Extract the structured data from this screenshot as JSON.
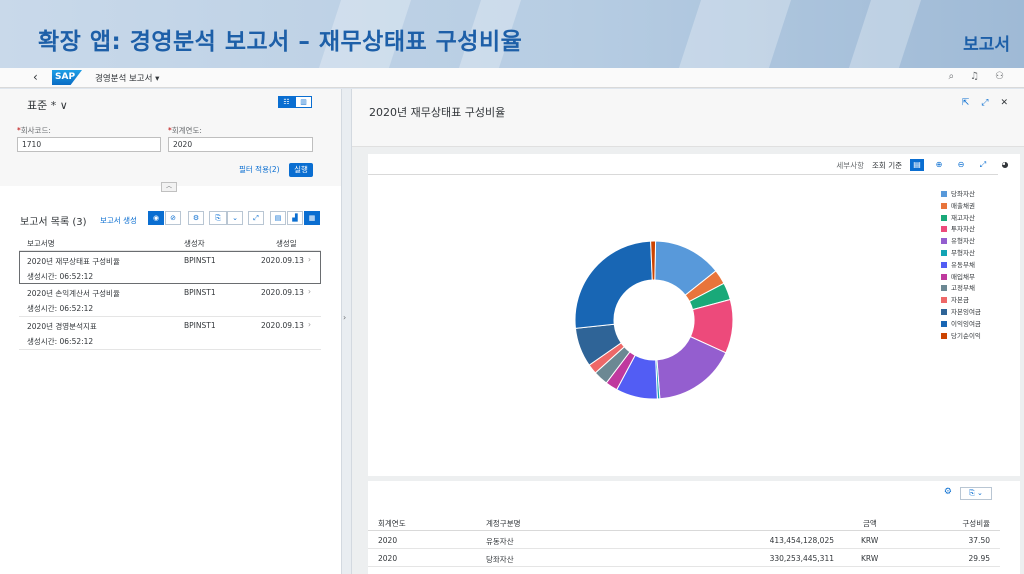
{
  "banner": {
    "title": "확장 앱: 경영분석 보고서 – 재무상태표 구성비율",
    "right_label": "보고서"
  },
  "shell": {
    "logo": "SAP",
    "app_title": "경영분석 보고서 ▾",
    "back_icon": "chevron-left-icon",
    "icons": [
      "search-icon",
      "bell-icon",
      "user-icon"
    ]
  },
  "filters": {
    "variant": "표준 * ∨",
    "company_code_label": "회사코드:",
    "company_code_value": "1710",
    "fiscal_year_label": "회계연도:",
    "fiscal_year_value": "2020",
    "apply_label": "필터 적용(2)",
    "go_label": "실행"
  },
  "report_list": {
    "title": "보고서 목록 (3)",
    "create_label": "보고서 생성",
    "columns": [
      "보고서명",
      "생성자",
      "생성일"
    ],
    "rows": [
      {
        "name": "2020년 재무상태표 구성비율",
        "creator": "BPINST1",
        "date": "2020.09.13",
        "time": "생성시간:  06:52:12",
        "selected": true
      },
      {
        "name": "2020년 손익계산서 구성비율",
        "creator": "BPINST1",
        "date": "2020.09.13",
        "time": "생성시간:  06:52:12",
        "selected": false
      },
      {
        "name": "2020년 경영분석지표",
        "creator": "BPINST1",
        "date": "2020.09.13",
        "time": "생성시간:  06:52:12",
        "selected": false
      }
    ]
  },
  "detail": {
    "title": "2020년 재무상태표 구성비율",
    "chart_tools": {
      "details": "세부사항",
      "view_by": "조회 기준"
    }
  },
  "chart_data": {
    "type": "pie",
    "donut": true,
    "legend_position": "right",
    "slices": [
      {
        "label": "당좌자산",
        "value": 14.0,
        "color": "#5899da"
      },
      {
        "label": "매출채권",
        "value": 3.0,
        "color": "#e8743b"
      },
      {
        "label": "재고자산",
        "value": 3.5,
        "color": "#19a979"
      },
      {
        "label": "투자자산",
        "value": 11.0,
        "color": "#ed4a7b"
      },
      {
        "label": "유형자산",
        "value": 17.0,
        "color": "#945ecf"
      },
      {
        "label": "무형자산",
        "value": 0.5,
        "color": "#13a4b4"
      },
      {
        "label": "유동부채",
        "value": 8.5,
        "color": "#525df4"
      },
      {
        "label": "매입채무",
        "value": 2.5,
        "color": "#bf399e"
      },
      {
        "label": "고정부채",
        "value": 3.0,
        "color": "#6c8893"
      },
      {
        "label": "자본금",
        "value": 2.0,
        "color": "#ee6868"
      },
      {
        "label": "자본잉여금",
        "value": 8.0,
        "color": "#2f6497"
      },
      {
        "label": "이익잉여금",
        "value": 26.0,
        "color": "#1866b4"
      },
      {
        "label": "당기순이익",
        "value": 1.0,
        "color": "#cc4300"
      }
    ]
  },
  "table": {
    "columns": [
      "회계연도",
      "계정구분명",
      "금액",
      "구성비율"
    ],
    "rows": [
      {
        "year": "2020",
        "account": "유동자산",
        "amount": "413,454,128,025",
        "currency": "KRW",
        "ratio": "37.50"
      },
      {
        "year": "2020",
        "account": "당좌자산",
        "amount": "330,253,445,311",
        "currency": "KRW",
        "ratio": "29.95"
      }
    ]
  }
}
